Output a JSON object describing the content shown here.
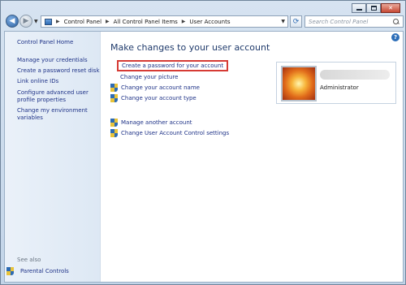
{
  "navigation": {
    "breadcrumbs": [
      "Control Panel",
      "All Control Panel Items",
      "User Accounts"
    ],
    "search_placeholder": "Search Control Panel"
  },
  "sidebar": {
    "home": "Control Panel Home",
    "links": [
      "Manage your credentials",
      "Create a password reset disk",
      "Link online IDs",
      "Configure advanced user profile properties",
      "Change my environment variables"
    ],
    "see_also_label": "See also",
    "parental_controls": "Parental Controls"
  },
  "main": {
    "title": "Make changes to your user account",
    "tasks": [
      "Create a password for your account",
      "Change your picture",
      "Change your account name",
      "Change your account type",
      "Manage another account",
      "Change User Account Control settings"
    ]
  },
  "account": {
    "role": "Administrator"
  },
  "icons": {
    "back": "back-arrow-icon",
    "forward": "forward-arrow-icon",
    "refresh": "refresh-icon",
    "search": "search-icon",
    "help": "help-icon",
    "shield": "uac-shield-icon"
  },
  "colors": {
    "link": "#1e3287",
    "highlight_border": "#d63b35",
    "title": "#1f3a6b"
  }
}
